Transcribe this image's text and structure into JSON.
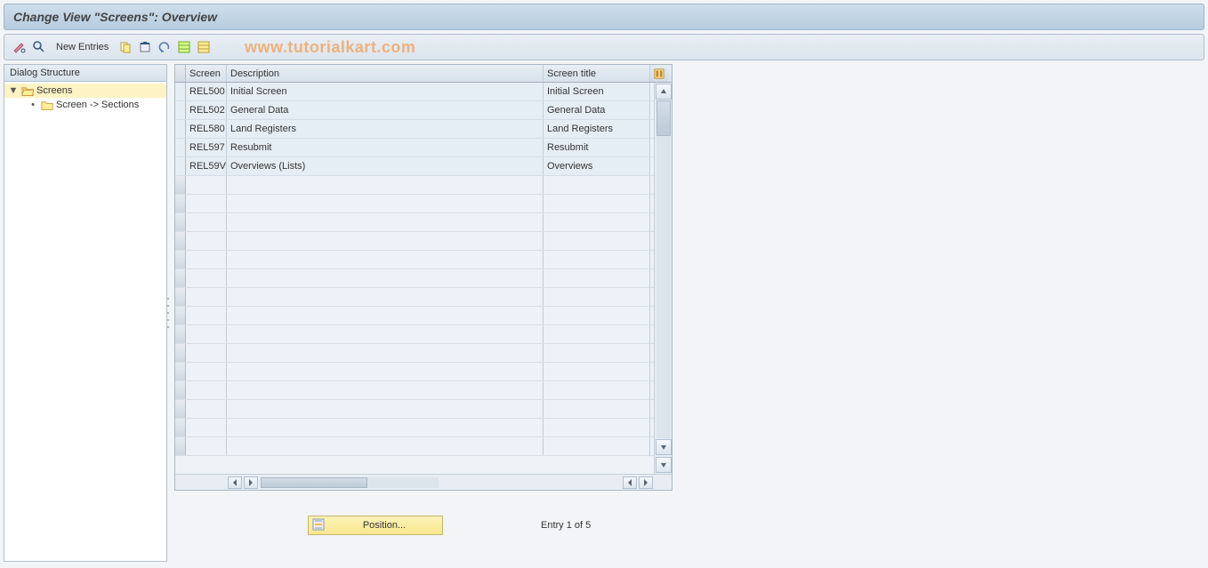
{
  "title": "Change View \"Screens\": Overview",
  "toolbar": {
    "new_entries_label": "New Entries"
  },
  "watermark": "www.tutorialkart.com",
  "tree": {
    "header": "Dialog Structure",
    "root_label": "Screens",
    "child_label": "Screen -> Sections"
  },
  "table": {
    "headers": {
      "screen": "Screen",
      "description": "Description",
      "title": "Screen title"
    },
    "rows": [
      {
        "screen": "REL500",
        "description": "Initial Screen",
        "title": "Initial Screen"
      },
      {
        "screen": "REL502",
        "description": "General Data",
        "title": "General Data"
      },
      {
        "screen": "REL580",
        "description": "Land Registers",
        "title": "Land Registers"
      },
      {
        "screen": "REL597",
        "description": "Resubmit",
        "title": "Resubmit"
      },
      {
        "screen": "REL59V",
        "description": "Overviews (Lists)",
        "title": "Overviews"
      }
    ],
    "empty_rows": 15
  },
  "footer": {
    "position_label": "Position...",
    "entry_text": "Entry 1 of 5"
  }
}
